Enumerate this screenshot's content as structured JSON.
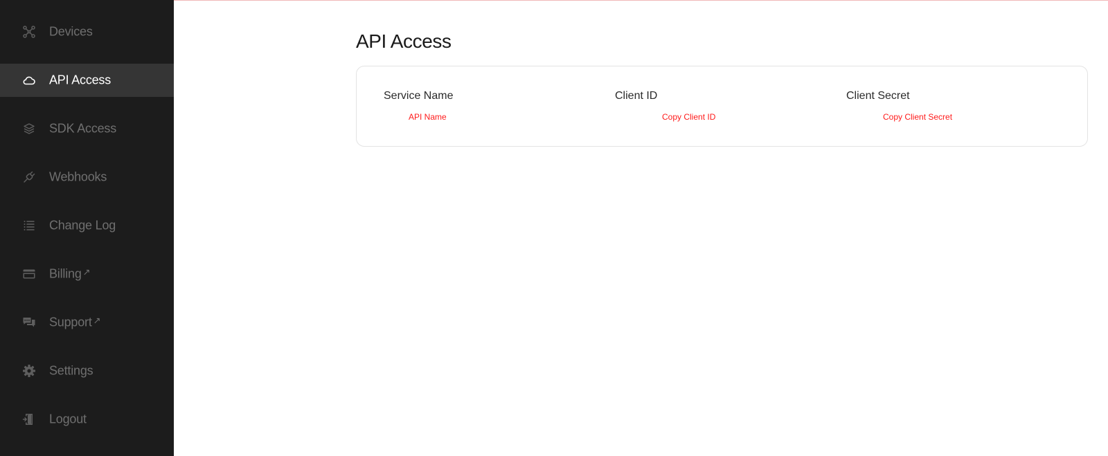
{
  "sidebar": {
    "items": [
      {
        "label": "Devices",
        "icon": "devices-icon",
        "active": false,
        "external": false
      },
      {
        "label": "API Access",
        "icon": "cloud-icon",
        "active": true,
        "external": false
      },
      {
        "label": "SDK Access",
        "icon": "layers-icon",
        "active": false,
        "external": false
      },
      {
        "label": "Webhooks",
        "icon": "plug-icon",
        "active": false,
        "external": false
      },
      {
        "label": "Change Log",
        "icon": "list-icon",
        "active": false,
        "external": false
      },
      {
        "label": "Billing",
        "icon": "credit-card-icon",
        "active": false,
        "external": true
      },
      {
        "label": "Support",
        "icon": "chat-icon",
        "active": false,
        "external": true
      },
      {
        "label": "Settings",
        "icon": "gear-icon",
        "active": false,
        "external": false
      },
      {
        "label": "Logout",
        "icon": "logout-icon",
        "active": false,
        "external": false
      }
    ],
    "external_arrow": "↗"
  },
  "main": {
    "title": "API Access",
    "card": {
      "columns": [
        {
          "header": "Service Name",
          "value": "API Name"
        },
        {
          "header": "Client ID",
          "value": "Copy Client ID"
        },
        {
          "header": "Client Secret",
          "value": "Copy Client Secret"
        }
      ]
    }
  },
  "colors": {
    "sidebar_bg": "#1c1c1c",
    "sidebar_active_bg": "#353535",
    "sidebar_text": "#6f6f6f",
    "sidebar_active_text": "#ffffff",
    "accent_red": "#ff1a1a"
  }
}
